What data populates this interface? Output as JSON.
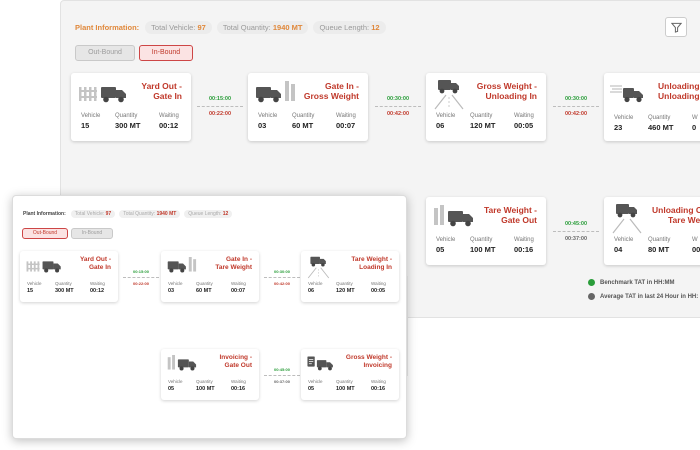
{
  "back": {
    "info": {
      "title": "Plant Information:",
      "total_vehicle_label": "Total Vehicle:",
      "total_vehicle_value": "97",
      "total_quantity_label": "Total Quantity:",
      "total_quantity_value": "1940 MT",
      "queue_length_label": "Queue Length:",
      "queue_length_value": "12"
    },
    "toggle": {
      "outbound": "Out-Bound",
      "inbound": "In-Bound",
      "active": "inbound"
    },
    "labels": {
      "vehicle": "Vehicle",
      "quantity": "Quantity",
      "waiting": "Waiting"
    },
    "cards": [
      {
        "title_l1": "Yard Out -",
        "title_l2": "Gate In",
        "vehicle": "15",
        "quantity": "300 MT",
        "waiting": "00:12"
      },
      {
        "title_l1": "Gate In -",
        "title_l2": "Gross Weight",
        "vehicle": "03",
        "quantity": "60 MT",
        "waiting": "00:07"
      },
      {
        "title_l1": "Gross Weight -",
        "title_l2": "Unloading In",
        "vehicle": "06",
        "quantity": "120 MT",
        "waiting": "00:05"
      },
      {
        "title_l1": "Unloading",
        "title_l2": "Unloading",
        "vehicle": "23",
        "quantity": "460 MT",
        "waiting": "0"
      },
      {
        "title_l1": "Tare Weight -",
        "title_l2": "Gate Out",
        "vehicle": "05",
        "quantity": "100 MT",
        "waiting": "00:16"
      },
      {
        "title_l1": "Unloading C",
        "title_l2": "Tare We",
        "vehicle": "04",
        "quantity": "80 MT",
        "waiting": "00"
      }
    ],
    "timings": [
      {
        "bench": "00:15:00",
        "avg": "00:22:00"
      },
      {
        "bench": "00:30:00",
        "avg": "00:42:00"
      },
      {
        "bench": "00:30:00",
        "avg": "00:42:00"
      },
      {
        "bench": "00:45:00",
        "avg": "00:37:00"
      }
    ],
    "legend": {
      "benchmark": "Benchmark TAT in HH:MM",
      "average": "Average TAT in last 24 Hour in HH:"
    }
  },
  "front": {
    "info": {
      "title": "Plant Information:",
      "total_vehicle_label": "Total Vehicle:",
      "total_vehicle_value": "97",
      "total_quantity_label": "Total Quantity:",
      "total_quantity_value": "1940 MT",
      "queue_length_label": "Queue Length:",
      "queue_length_value": "12"
    },
    "toggle": {
      "outbound": "Out-Bound",
      "inbound": "In-Bound",
      "active": "outbound"
    },
    "labels": {
      "vehicle": "Vehicle",
      "quantity": "Quantity",
      "waiting": "Waiting"
    },
    "cards": [
      {
        "title_l1": "Yard Out -",
        "title_l2": "Gate In",
        "vehicle": "15",
        "quantity": "300 MT",
        "waiting": "00:12"
      },
      {
        "title_l1": "Gate In -",
        "title_l2": "Tare Weight",
        "vehicle": "03",
        "quantity": "60 MT",
        "waiting": "00:07"
      },
      {
        "title_l1": "Tare Weight -",
        "title_l2": "Loading In",
        "vehicle": "06",
        "quantity": "120 MT",
        "waiting": "00:05"
      },
      {
        "title_l1": "Invoicing -",
        "title_l2": "Gate Out",
        "vehicle": "05",
        "quantity": "100 MT",
        "waiting": "00:16"
      },
      {
        "title_l1": "Gross Weight -",
        "title_l2": "Invoicing",
        "vehicle": "05",
        "quantity": "100 MT",
        "waiting": "00:16"
      }
    ],
    "timings": [
      {
        "bench": "00:15:00",
        "avg": "00:22:00"
      },
      {
        "bench": "00:30:00",
        "avg": "00:42:00"
      },
      {
        "bench": "00:45:00",
        "avg": "00:37:00"
      }
    ]
  },
  "icons": [
    "yard-truck-icon",
    "gate-truck-icon",
    "weighbridge-icon",
    "unloading-truck-icon",
    "invoice-truck-icon",
    "filter-icon"
  ],
  "colors": {
    "accent": "#c0392b",
    "info_title": "#e0883b",
    "benchmark": "#2a9d3a",
    "average": "#666666"
  }
}
